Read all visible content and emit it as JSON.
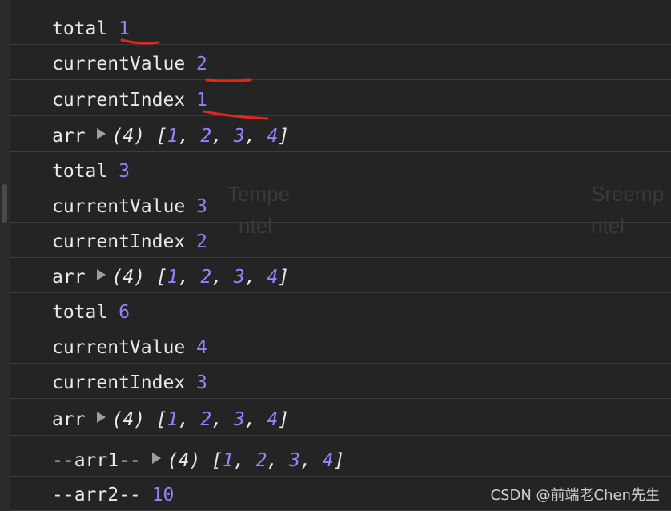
{
  "rows": [
    {
      "label": "total",
      "value": "1"
    },
    {
      "label": "currentValue",
      "value": "2"
    },
    {
      "label": "currentIndex",
      "value": "1"
    },
    {
      "label": "arr",
      "count": "(4)",
      "items": [
        "1",
        "2",
        "3",
        "4"
      ]
    },
    {
      "label": "total",
      "value": "3"
    },
    {
      "label": "currentValue",
      "value": "3"
    },
    {
      "label": "currentIndex",
      "value": "2"
    },
    {
      "label": "arr",
      "count": "(4)",
      "items": [
        "1",
        "2",
        "3",
        "4"
      ]
    },
    {
      "label": "total",
      "value": "6"
    },
    {
      "label": "currentValue",
      "value": "4"
    },
    {
      "label": "currentIndex",
      "value": "3"
    },
    {
      "label": "arr",
      "count": "(4)",
      "items": [
        "1",
        "2",
        "3",
        "4"
      ]
    },
    {
      "label": "--arr1--",
      "count": "(4)",
      "items": [
        "1",
        "2",
        "3",
        "4"
      ]
    },
    {
      "label": "--arr2--",
      "value": "10"
    }
  ],
  "ghost_text": [
    "Tempe",
    "ntel",
    "Sreemp",
    "ntel"
  ],
  "watermark": "CSDN @前端老Chen先生",
  "colors": {
    "background": "#242424",
    "number": "#9980ff",
    "text": "#e8eaed",
    "underline": "#e8271c"
  },
  "icons": {
    "expand": "triangle-right-icon"
  }
}
